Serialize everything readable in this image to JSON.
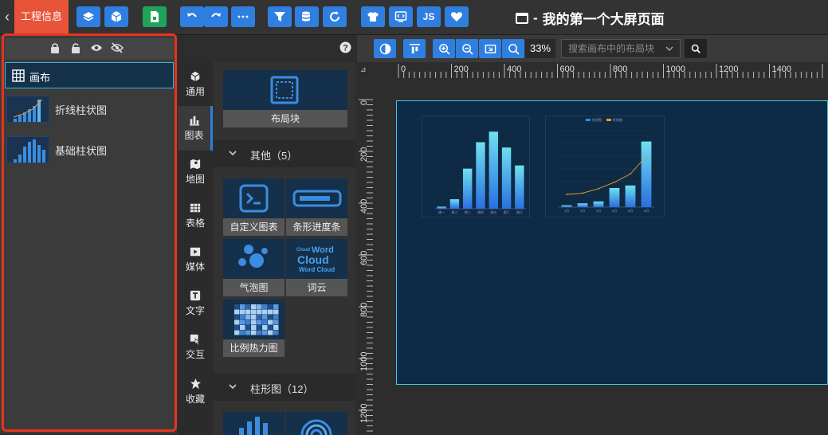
{
  "topbar": {
    "project_tab": "工程信息",
    "page_title": "我的第一个大屏页面",
    "js_label": "JS"
  },
  "layers": {
    "items": [
      {
        "label": "画布"
      },
      {
        "label": "折线柱状图"
      },
      {
        "label": "基础柱状图"
      }
    ]
  },
  "categories": [
    {
      "label": "通用",
      "icon": "cube-icon"
    },
    {
      "label": "图表",
      "icon": "bar-chart-icon"
    },
    {
      "label": "地图",
      "icon": "map-icon"
    },
    {
      "label": "表格",
      "icon": "table-icon"
    },
    {
      "label": "媒体",
      "icon": "media-icon"
    },
    {
      "label": "文字",
      "icon": "text-icon"
    },
    {
      "label": "交互",
      "icon": "interact-icon"
    },
    {
      "label": "收藏",
      "icon": "star-icon"
    }
  ],
  "library": {
    "layout_block": "布局块",
    "section_other": "其他（5）",
    "section_bar": "柱形图（12）",
    "cards": [
      {
        "label": "自定义图表"
      },
      {
        "label": "条形进度条"
      },
      {
        "label": "气泡图"
      },
      {
        "label": "词云"
      },
      {
        "label": "比例热力图"
      }
    ],
    "wordcloud_words": [
      "Cloud",
      "Word",
      "Cloud",
      "Word Cloud"
    ]
  },
  "main": {
    "zoom": "33%",
    "search_placeholder": "搜索画布中的布局块",
    "ruler_h": [
      "0",
      "200",
      "400",
      "600",
      "800",
      "1000",
      "1200",
      "1400"
    ],
    "ruler_v": [
      "0",
      "200",
      "400",
      "600",
      "800",
      "1000",
      "1200"
    ]
  },
  "chart_data": [
    {
      "type": "bar",
      "categories": [
        "周一",
        "周二",
        "周三",
        "周四",
        "周五",
        "周六",
        "周日"
      ],
      "values": [
        2,
        9,
        38,
        63,
        73,
        58,
        41
      ],
      "ylim": [
        0,
        80
      ]
    },
    {
      "type": "bar",
      "categories": [
        "1月",
        "2月",
        "3月",
        "4月",
        "5月",
        "6月"
      ],
      "series": [
        {
          "name": "柱状图",
          "type": "bar",
          "values": [
            3,
            6,
            9,
            30,
            34,
            103
          ]
        },
        {
          "name": "折线图",
          "type": "line",
          "values": [
            20,
            22,
            29,
            39,
            52,
            80
          ]
        }
      ],
      "ylim": [
        0,
        120
      ],
      "colors": {
        "bar": "#2f8cf0",
        "line": "#e0a030"
      }
    }
  ]
}
